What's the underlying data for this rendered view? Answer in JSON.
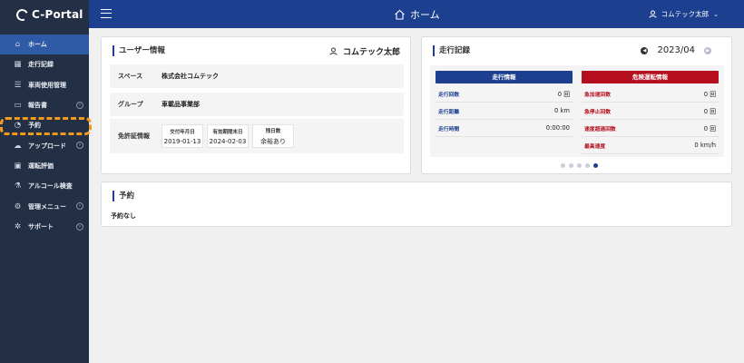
{
  "app": {
    "logo": "C-Portal"
  },
  "sidebar": {
    "items": [
      {
        "label": "ホーム",
        "icon": "home-icon",
        "glyph": "⌂",
        "active": true
      },
      {
        "label": "走行記録",
        "icon": "calendar-icon",
        "glyph": "▦"
      },
      {
        "label": "車両使用管理",
        "icon": "list-icon",
        "glyph": "☰"
      },
      {
        "label": "報告書",
        "icon": "document-icon",
        "glyph": "▭",
        "expandable": true
      },
      {
        "label": "予約",
        "icon": "clock-icon",
        "glyph": "◔"
      },
      {
        "label": "アップロード",
        "icon": "cloud-upload-icon",
        "glyph": "☁",
        "expandable": true
      },
      {
        "label": "運転評価",
        "icon": "car-icon",
        "glyph": "▣"
      },
      {
        "label": "アルコール検査",
        "icon": "breathalyzer-icon",
        "glyph": "⚗"
      },
      {
        "label": "管理メニュー",
        "icon": "gear-icon",
        "glyph": "⚙",
        "expandable": true
      },
      {
        "label": "サポート",
        "icon": "support-icon",
        "glyph": "✲",
        "expandable": true
      }
    ]
  },
  "header": {
    "title": "ホーム",
    "user": "コムテック太郎"
  },
  "user_info": {
    "title": "ユーザー情報",
    "name": "コムテック太郎",
    "space_label": "スペース",
    "space_value": "株式会社コムテック",
    "group_label": "グループ",
    "group_value": "車載品事業部",
    "license_label": "免許証情報",
    "license": {
      "issued_label": "交付年月日",
      "issued": "2019-01-13",
      "expiry_label": "有効期間末日",
      "expiry": "2024-02-03",
      "days_label": "残日数",
      "days": "余裕あり"
    }
  },
  "run_record": {
    "title": "走行記録",
    "month": "2023/04",
    "driving": {
      "title": "走行情報",
      "rows": [
        {
          "label": "走行回数",
          "value": "0 回"
        },
        {
          "label": "走行距離",
          "value": "0 km"
        },
        {
          "label": "走行時間",
          "value": "0:00:00"
        }
      ]
    },
    "danger": {
      "title": "危険運転情報",
      "rows": [
        {
          "label": "急加速回数",
          "value": "0 回"
        },
        {
          "label": "急停止回数",
          "value": "0 回"
        },
        {
          "label": "速度超過回数",
          "value": "0 回"
        },
        {
          "label": "最高速度",
          "value": "0 km/h"
        }
      ]
    },
    "pages": 5,
    "active_page": 5
  },
  "reservation": {
    "title": "予約",
    "empty": "予約なし"
  },
  "colors": {
    "sidebar": "#232f44",
    "header": "#1d3f8f",
    "active": "#2e5aa6",
    "danger": "#b50e1e",
    "highlight": "#f39a1c"
  }
}
